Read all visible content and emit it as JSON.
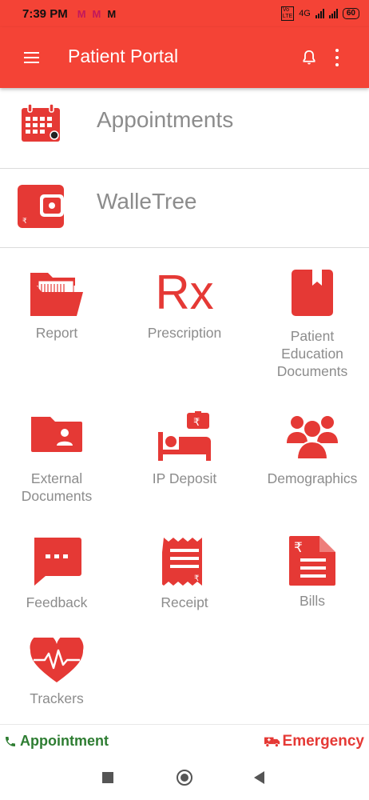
{
  "status_bar": {
    "time": "7:39 PM",
    "app_icons": [
      "M",
      "M",
      "M"
    ],
    "network": "4G",
    "battery": "60"
  },
  "app_bar": {
    "title": "Patient Portal",
    "icons": [
      "hamburger-menu-icon",
      "bell-icon",
      "more-vert-icon"
    ]
  },
  "list": [
    {
      "label": "Appointments",
      "icon": "calendar-icon"
    },
    {
      "label": "WalleTree",
      "icon": "wallet-icon"
    }
  ],
  "grid": [
    {
      "label": "Report",
      "icon": "folder-open-icon"
    },
    {
      "label": "Prescription",
      "icon": "rx-icon",
      "glyph": "Rx"
    },
    {
      "label": "Patient Education Documents",
      "icon": "book-icon"
    },
    {
      "label": "External Documents",
      "icon": "folder-person-icon"
    },
    {
      "label": "IP Deposit",
      "icon": "hospital-bed-icon"
    },
    {
      "label": "Demographics",
      "icon": "people-group-icon"
    },
    {
      "label": "Feedback",
      "icon": "chat-bubble-icon"
    },
    {
      "label": "Receipt",
      "icon": "receipt-icon"
    },
    {
      "label": "Bills",
      "icon": "bill-document-icon"
    },
    {
      "label": "Trackers",
      "icon": "heart-pulse-icon"
    }
  ],
  "bottom_actions": {
    "appointment": "Appointment",
    "emergency": "Emergency"
  },
  "colors": {
    "primary": "#f44336",
    "icon_red": "#e53935",
    "label_gray": "#8c8c8c",
    "appointment_green": "#2e7d32"
  }
}
